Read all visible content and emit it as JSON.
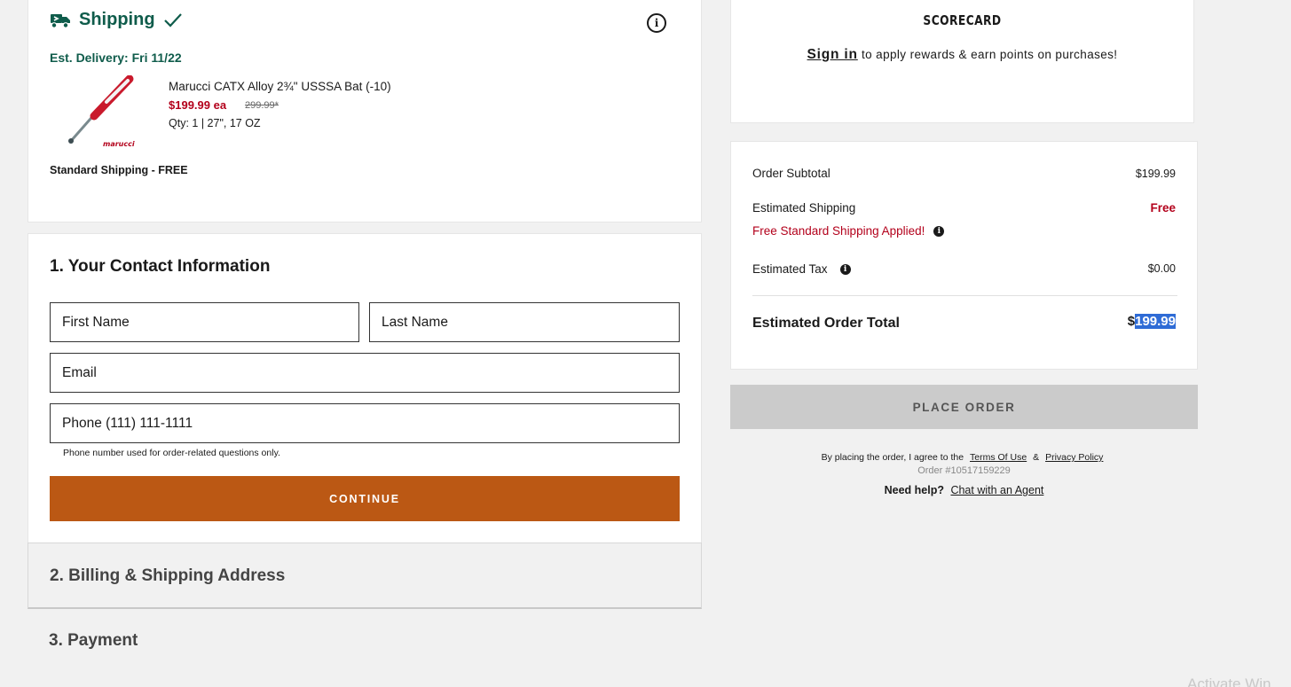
{
  "shipping": {
    "title": "Shipping",
    "delivery": "Est. Delivery: Fri 11/22",
    "info_icon": "info-icon",
    "product": {
      "name": "Marucci CATX Alloy 2¾\" USSSA Bat (-10)",
      "price": "$199.99 ea",
      "original_price": "299.99*",
      "qty": "Qty: 1 | 27\", 17 OZ",
      "image_text": "marucci",
      "image_icon": "baseball-bat-image"
    },
    "method": "Standard Shipping - FREE",
    "colors": {
      "accent": "#0f5c4b",
      "sale": "#b3001b"
    }
  },
  "contact": {
    "title": "1. Your Contact Information",
    "first_name_placeholder": "First Name",
    "last_name_placeholder": "Last Name",
    "email_placeholder": "Email",
    "phone_placeholder": "Phone (111) 111-1111",
    "phone_note": "Phone number used for order-related questions only.",
    "continue_label": "CONTINUE",
    "continue_color": "#bb5814"
  },
  "billing": {
    "title": "2. Billing & Shipping Address"
  },
  "payment": {
    "title": "3. Payment"
  },
  "scorecard": {
    "logo": "SCORECARD",
    "sign_in": "Sign in",
    "text": "to apply rewards & earn points on purchases!"
  },
  "summary": {
    "subtotal_label": "Order Subtotal",
    "subtotal_value": "$199.99",
    "shipping_label": "Estimated Shipping",
    "shipping_value": "Free",
    "free_applied": "Free Standard Shipping Applied!",
    "tax_label": "Estimated Tax",
    "tax_value": "$0.00",
    "total_label": "Estimated Order Total",
    "total_currency": "$",
    "total_amount": "199.99"
  },
  "place_order_label": "PLACE ORDER",
  "terms": {
    "prefix": "By placing the order, I agree to the",
    "terms_link": "Terms Of Use",
    "and": "&",
    "privacy_link": "Privacy Policy"
  },
  "order_number": "Order #10517159229",
  "help": {
    "prefix": "Need help?",
    "link": "Chat with an Agent"
  },
  "watermark": "Activate Win"
}
